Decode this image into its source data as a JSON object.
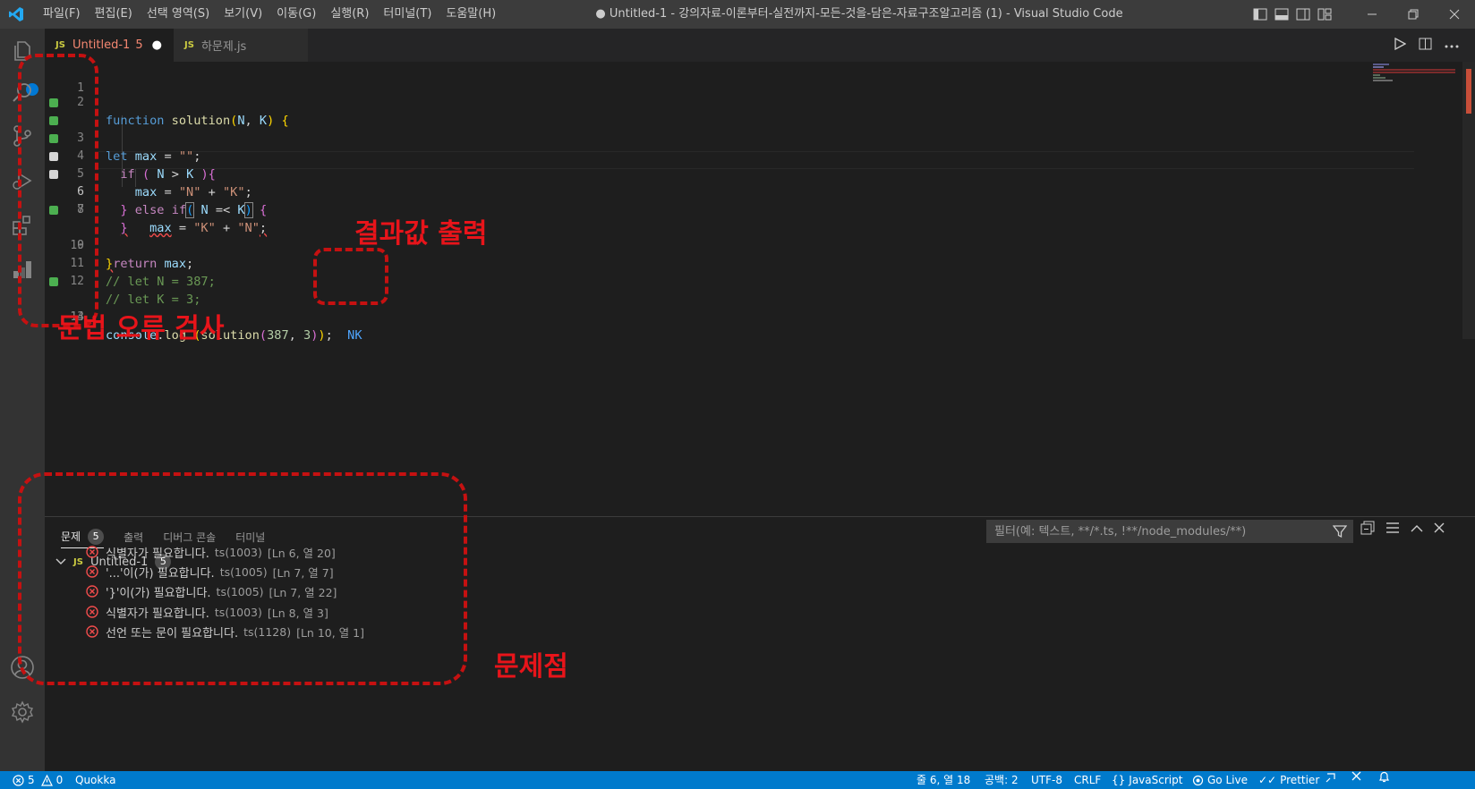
{
  "titlebar": {
    "menu": [
      "파일(F)",
      "편집(E)",
      "선택 영역(S)",
      "보기(V)",
      "이동(G)",
      "실행(R)",
      "터미널(T)",
      "도움말(H)"
    ],
    "window_title": "● Untitled-1 - 강의자료-이론부터-실전까지-모든-것을-담은-자료구조알고리즘 (1) - Visual Studio Code"
  },
  "tabs": [
    {
      "badge": "JS",
      "label": "Untitled-1",
      "problem_count": "5",
      "dirty": "●"
    },
    {
      "badge": "JS",
      "label": "하문제.js"
    }
  ],
  "editor": {
    "line_numbers": [
      "1",
      "2",
      "3",
      "4",
      "5",
      "6",
      "7",
      "8",
      "9",
      "10",
      "11",
      "12",
      "13",
      "14"
    ],
    "active_line": "6",
    "inline_result": "NK",
    "colors": {
      "modified": "#4caf50",
      "changed": "#d6d6d6"
    }
  },
  "panel": {
    "tabs": [
      {
        "label": "문제",
        "count": "5"
      },
      {
        "label": "출력"
      },
      {
        "label": "디버그 콘솔"
      },
      {
        "label": "터미널"
      }
    ],
    "filter_placeholder": "필터(예: 텍스트, **/*.ts, !**/node_modules/**)",
    "group": {
      "badge": "JS",
      "label": "Untitled-1",
      "count": "5"
    },
    "problems": [
      {
        "message": "식별자가 필요합니다.",
        "code": "ts(1003)",
        "location": "[Ln 6, 열 20]"
      },
      {
        "message": "'...'이(가) 필요합니다.",
        "code": "ts(1005)",
        "location": "[Ln 7, 열 7]"
      },
      {
        "message": "'}'이(가) 필요합니다.",
        "code": "ts(1005)",
        "location": "[Ln 7, 열 22]"
      },
      {
        "message": "식별자가 필요합니다.",
        "code": "ts(1003)",
        "location": "[Ln 8, 열 3]"
      },
      {
        "message": "선언 또는 문이 필요합니다.",
        "code": "ts(1128)",
        "location": "[Ln 10, 열 1]"
      }
    ]
  },
  "statusbar": {
    "errors": "5",
    "warnings": "0",
    "quokka": "Quokka",
    "position": "줄 6, 열 18",
    "spaces": "공백: 2",
    "encoding": "UTF-8",
    "eol": "CRLF",
    "language": "JavaScript",
    "golive": "Go Live",
    "prettier": "Prettier"
  },
  "annotations": {
    "syntax_check": "문법 오류 검사",
    "result_output": "결과값 출력",
    "problems": "문제점",
    "color": "#e8141a"
  }
}
